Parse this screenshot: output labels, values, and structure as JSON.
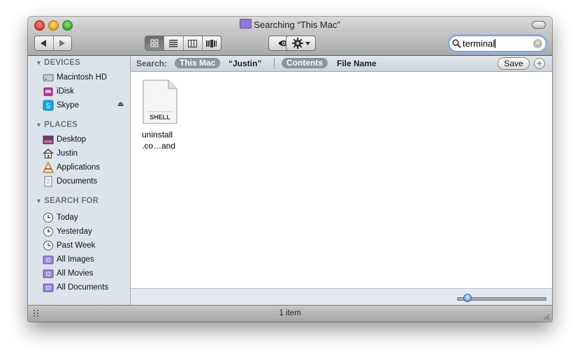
{
  "window": {
    "title": "Searching “This Mac”"
  },
  "toolbar": {
    "back_icon": "back-arrow-icon",
    "forward_icon": "forward-arrow-icon",
    "view_modes": [
      "icon-view",
      "list-view",
      "column-view",
      "cover-flow-view"
    ],
    "active_view": "icon-view",
    "quicklook_icon": "eye-icon",
    "action_icon": "gear-icon"
  },
  "search": {
    "value": "terminal"
  },
  "sidebar": {
    "devices": {
      "header": "DEVICES",
      "items": [
        {
          "label": "Macintosh HD",
          "icon": "hard-drive-icon"
        },
        {
          "label": "iDisk",
          "icon": "idisk-icon"
        },
        {
          "label": "Skype",
          "icon": "skype-icon",
          "eject": "⏏"
        }
      ]
    },
    "places": {
      "header": "PLACES",
      "items": [
        {
          "label": "Desktop",
          "icon": "desktop-icon"
        },
        {
          "label": "Justin",
          "icon": "home-icon"
        },
        {
          "label": "Applications",
          "icon": "applications-icon"
        },
        {
          "label": "Documents",
          "icon": "documents-icon"
        }
      ]
    },
    "search_for": {
      "header": "SEARCH FOR",
      "items": [
        {
          "label": "Today",
          "icon": "clock-icon"
        },
        {
          "label": "Yesterday",
          "icon": "clock-icon"
        },
        {
          "label": "Past Week",
          "icon": "clock-icon"
        },
        {
          "label": "All Images",
          "icon": "smart-folder-icon"
        },
        {
          "label": "All Movies",
          "icon": "smart-folder-icon"
        },
        {
          "label": "All Documents",
          "icon": "smart-folder-icon"
        }
      ]
    }
  },
  "searchbar": {
    "label": "Search:",
    "scopes": [
      "This Mac",
      "“Justin”"
    ],
    "active_scope": "This Mac",
    "criteria": [
      "Contents",
      "File Name"
    ],
    "active_criteria": "Contents",
    "save_label": "Save",
    "add_label": "+"
  },
  "results": [
    {
      "badge": "SHELL",
      "name_line1": "uninstall",
      "name_line2": ".co…and",
      "icon": "shell-script-icon"
    }
  ],
  "status": {
    "text": "1 item"
  }
}
